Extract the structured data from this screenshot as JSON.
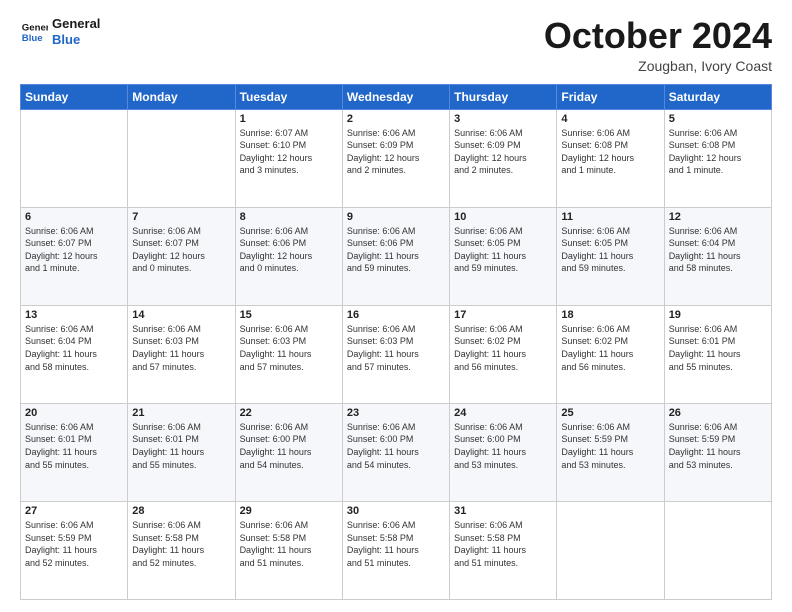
{
  "header": {
    "logo_line1": "General",
    "logo_line2": "Blue",
    "month": "October 2024",
    "location": "Zougban, Ivory Coast"
  },
  "weekdays": [
    "Sunday",
    "Monday",
    "Tuesday",
    "Wednesday",
    "Thursday",
    "Friday",
    "Saturday"
  ],
  "weeks": [
    [
      {
        "day": "",
        "info": ""
      },
      {
        "day": "",
        "info": ""
      },
      {
        "day": "1",
        "info": "Sunrise: 6:07 AM\nSunset: 6:10 PM\nDaylight: 12 hours\nand 3 minutes."
      },
      {
        "day": "2",
        "info": "Sunrise: 6:06 AM\nSunset: 6:09 PM\nDaylight: 12 hours\nand 2 minutes."
      },
      {
        "day": "3",
        "info": "Sunrise: 6:06 AM\nSunset: 6:09 PM\nDaylight: 12 hours\nand 2 minutes."
      },
      {
        "day": "4",
        "info": "Sunrise: 6:06 AM\nSunset: 6:08 PM\nDaylight: 12 hours\nand 1 minute."
      },
      {
        "day": "5",
        "info": "Sunrise: 6:06 AM\nSunset: 6:08 PM\nDaylight: 12 hours\nand 1 minute."
      }
    ],
    [
      {
        "day": "6",
        "info": "Sunrise: 6:06 AM\nSunset: 6:07 PM\nDaylight: 12 hours\nand 1 minute."
      },
      {
        "day": "7",
        "info": "Sunrise: 6:06 AM\nSunset: 6:07 PM\nDaylight: 12 hours\nand 0 minutes."
      },
      {
        "day": "8",
        "info": "Sunrise: 6:06 AM\nSunset: 6:06 PM\nDaylight: 12 hours\nand 0 minutes."
      },
      {
        "day": "9",
        "info": "Sunrise: 6:06 AM\nSunset: 6:06 PM\nDaylight: 11 hours\nand 59 minutes."
      },
      {
        "day": "10",
        "info": "Sunrise: 6:06 AM\nSunset: 6:05 PM\nDaylight: 11 hours\nand 59 minutes."
      },
      {
        "day": "11",
        "info": "Sunrise: 6:06 AM\nSunset: 6:05 PM\nDaylight: 11 hours\nand 59 minutes."
      },
      {
        "day": "12",
        "info": "Sunrise: 6:06 AM\nSunset: 6:04 PM\nDaylight: 11 hours\nand 58 minutes."
      }
    ],
    [
      {
        "day": "13",
        "info": "Sunrise: 6:06 AM\nSunset: 6:04 PM\nDaylight: 11 hours\nand 58 minutes."
      },
      {
        "day": "14",
        "info": "Sunrise: 6:06 AM\nSunset: 6:03 PM\nDaylight: 11 hours\nand 57 minutes."
      },
      {
        "day": "15",
        "info": "Sunrise: 6:06 AM\nSunset: 6:03 PM\nDaylight: 11 hours\nand 57 minutes."
      },
      {
        "day": "16",
        "info": "Sunrise: 6:06 AM\nSunset: 6:03 PM\nDaylight: 11 hours\nand 57 minutes."
      },
      {
        "day": "17",
        "info": "Sunrise: 6:06 AM\nSunset: 6:02 PM\nDaylight: 11 hours\nand 56 minutes."
      },
      {
        "day": "18",
        "info": "Sunrise: 6:06 AM\nSunset: 6:02 PM\nDaylight: 11 hours\nand 56 minutes."
      },
      {
        "day": "19",
        "info": "Sunrise: 6:06 AM\nSunset: 6:01 PM\nDaylight: 11 hours\nand 55 minutes."
      }
    ],
    [
      {
        "day": "20",
        "info": "Sunrise: 6:06 AM\nSunset: 6:01 PM\nDaylight: 11 hours\nand 55 minutes."
      },
      {
        "day": "21",
        "info": "Sunrise: 6:06 AM\nSunset: 6:01 PM\nDaylight: 11 hours\nand 55 minutes."
      },
      {
        "day": "22",
        "info": "Sunrise: 6:06 AM\nSunset: 6:00 PM\nDaylight: 11 hours\nand 54 minutes."
      },
      {
        "day": "23",
        "info": "Sunrise: 6:06 AM\nSunset: 6:00 PM\nDaylight: 11 hours\nand 54 minutes."
      },
      {
        "day": "24",
        "info": "Sunrise: 6:06 AM\nSunset: 6:00 PM\nDaylight: 11 hours\nand 53 minutes."
      },
      {
        "day": "25",
        "info": "Sunrise: 6:06 AM\nSunset: 5:59 PM\nDaylight: 11 hours\nand 53 minutes."
      },
      {
        "day": "26",
        "info": "Sunrise: 6:06 AM\nSunset: 5:59 PM\nDaylight: 11 hours\nand 53 minutes."
      }
    ],
    [
      {
        "day": "27",
        "info": "Sunrise: 6:06 AM\nSunset: 5:59 PM\nDaylight: 11 hours\nand 52 minutes."
      },
      {
        "day": "28",
        "info": "Sunrise: 6:06 AM\nSunset: 5:58 PM\nDaylight: 11 hours\nand 52 minutes."
      },
      {
        "day": "29",
        "info": "Sunrise: 6:06 AM\nSunset: 5:58 PM\nDaylight: 11 hours\nand 51 minutes."
      },
      {
        "day": "30",
        "info": "Sunrise: 6:06 AM\nSunset: 5:58 PM\nDaylight: 11 hours\nand 51 minutes."
      },
      {
        "day": "31",
        "info": "Sunrise: 6:06 AM\nSunset: 5:58 PM\nDaylight: 11 hours\nand 51 minutes."
      },
      {
        "day": "",
        "info": ""
      },
      {
        "day": "",
        "info": ""
      }
    ]
  ]
}
